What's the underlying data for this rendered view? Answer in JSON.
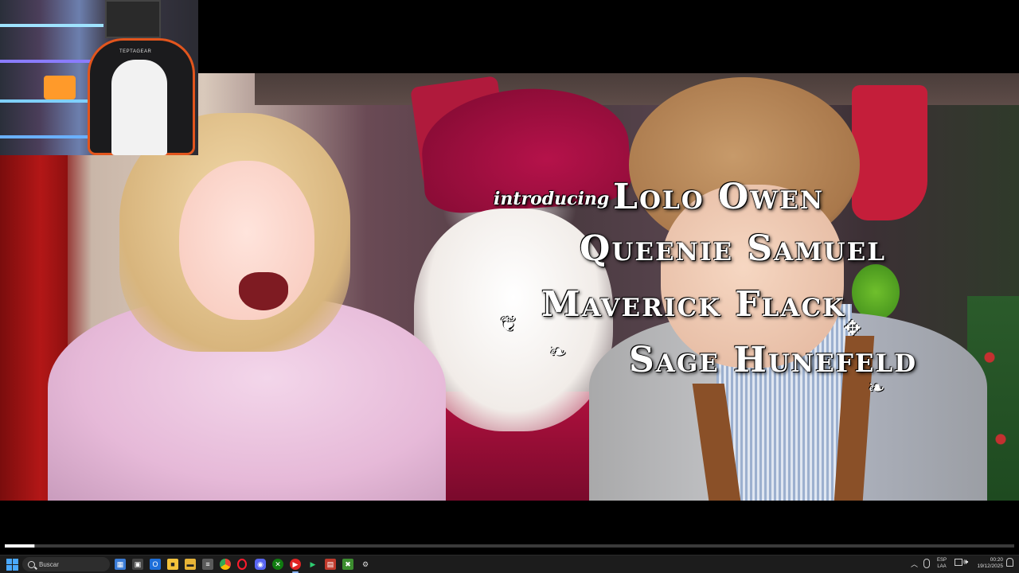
{
  "video": {
    "credits": {
      "intro": "introducing",
      "names": [
        "Lolo Owen",
        "Queenie Samuel",
        "Maverick Flack",
        "Sage Hunefeld"
      ]
    },
    "progress_fraction": 0.029,
    "buffered_fraction": 0.03
  },
  "webcam": {
    "chair_brand": "TEPTAGEAR"
  },
  "taskbar": {
    "search_placeholder": "Buscar",
    "apps": [
      "start-icon",
      "files-icon",
      "outlook-icon",
      "file-explorer-icon",
      "sticky-notes-icon",
      "notepad-icon",
      "chrome-icon",
      "opera-icon",
      "discord-icon",
      "xbox-icon",
      "youtube-icon",
      "media-player-icon",
      "photo-editor-icon",
      "minecraft-icon",
      "settings-icon"
    ],
    "tray": {
      "lang_line1": "ESP",
      "lang_line2": "LAA",
      "time": "00:20",
      "date": "19/12/2025"
    }
  },
  "colors": {
    "progress": "#ffffff",
    "taskbar": "#1c1c1c",
    "accent": "#4aa8ff"
  }
}
